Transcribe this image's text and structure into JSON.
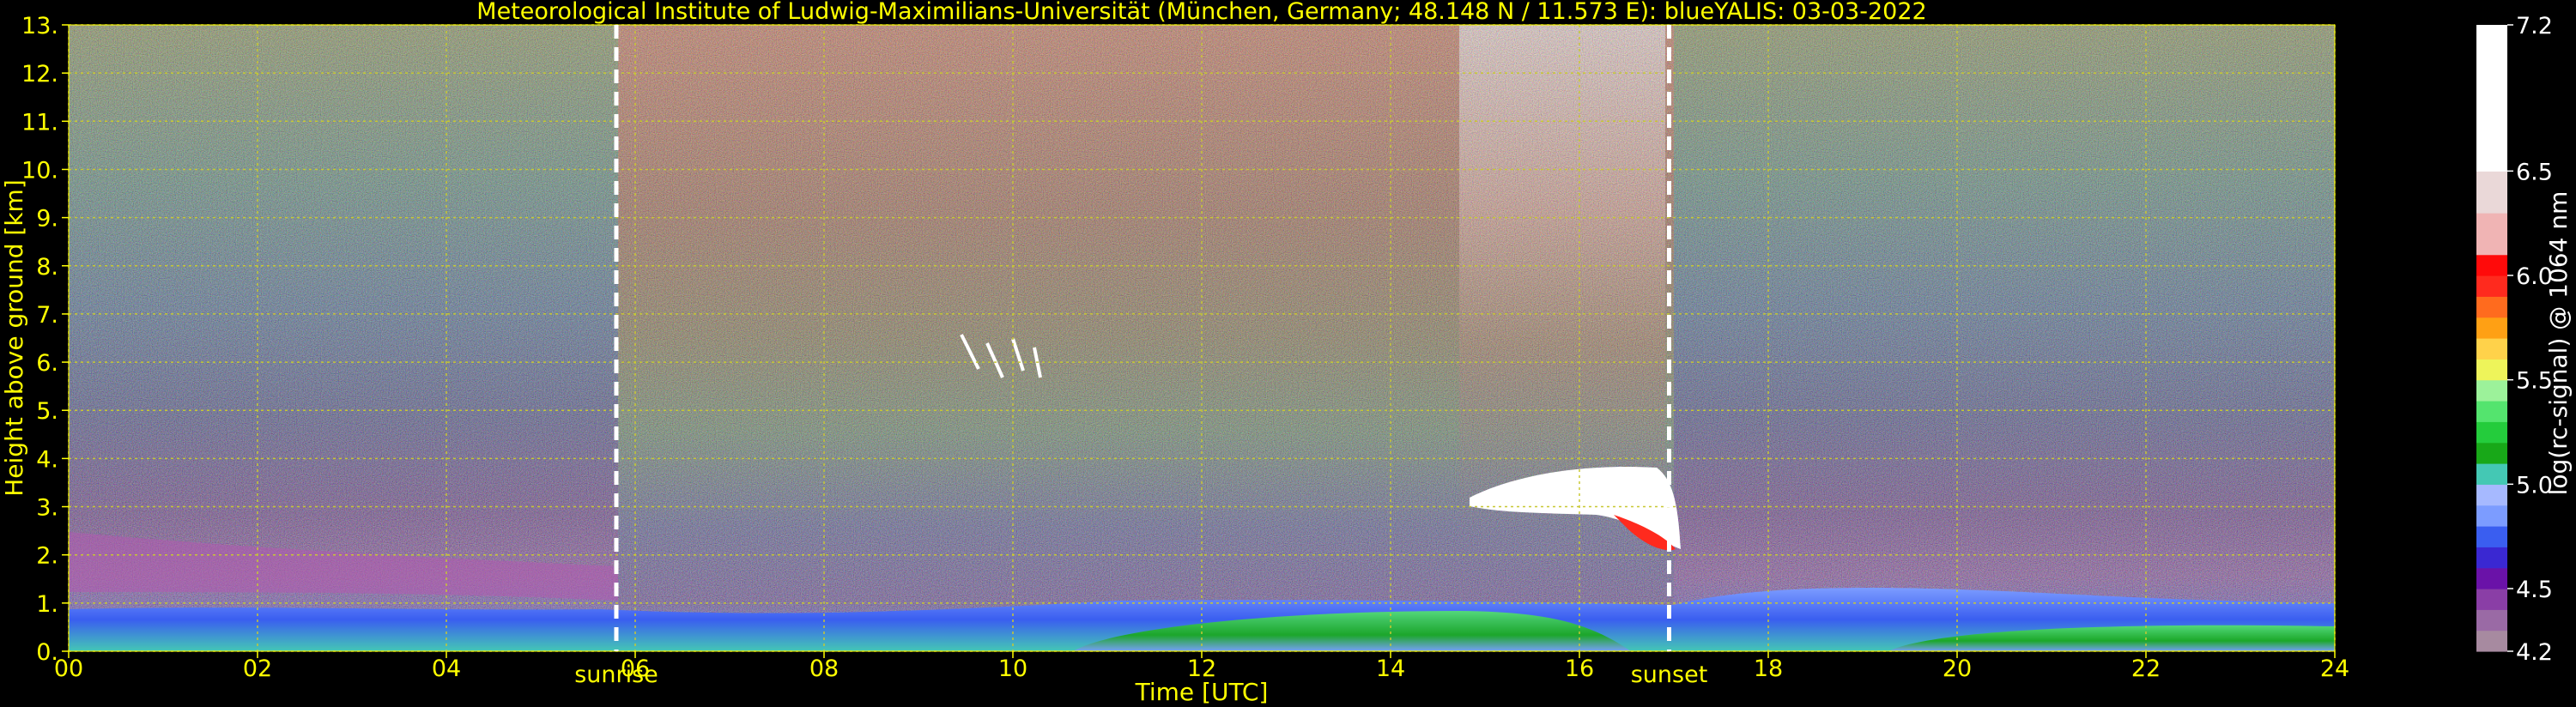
{
  "chart_data": {
    "type": "heatmap",
    "title": "Meteorological Institute of Ludwig-Maximilians-Universität (München, Germany; 48.148 N / 11.573 E):     blueYALIS: 03-03-2022",
    "xlabel": "Time [UTC]",
    "ylabel": "Height above ground [km]",
    "xlim": [
      0,
      24
    ],
    "ylim": [
      0,
      13
    ],
    "xticks": [
      "00",
      "02",
      "04",
      "06",
      "08",
      "10",
      "12",
      "14",
      "16",
      "18",
      "20",
      "22",
      "24"
    ],
    "yticks": [
      "0.",
      "1.",
      "2.",
      "3.",
      "4.",
      "5.",
      "6.",
      "7.",
      "8.",
      "9.",
      "10.",
      "11.",
      "12.",
      "13."
    ],
    "grid": true,
    "annotations": [
      {
        "label": "sunrise",
        "x": 5.8
      },
      {
        "label": "sunset",
        "x": 16.95
      }
    ],
    "colorbar": {
      "label": "log(rc-signal) @ 1064 nm",
      "range": [
        4.2,
        7.2
      ],
      "tick_values": [
        4.2,
        4.5,
        5.0,
        5.5,
        6.0,
        6.5,
        7.2
      ],
      "tick_labels": [
        "4.2",
        "4.5",
        "5.0",
        "5.5",
        "6.0",
        "6.5",
        "7.2"
      ],
      "levels": [
        {
          "from": 4.2,
          "to": 4.3,
          "color": "#a78aa0"
        },
        {
          "from": 4.3,
          "to": 4.4,
          "color": "#9a6aa5"
        },
        {
          "from": 4.4,
          "to": 4.5,
          "color": "#8a3ea6"
        },
        {
          "from": 4.5,
          "to": 4.6,
          "color": "#6a12a8"
        },
        {
          "from": 4.6,
          "to": 4.7,
          "color": "#3a28d2"
        },
        {
          "from": 4.7,
          "to": 4.8,
          "color": "#3a5ef0"
        },
        {
          "from": 4.8,
          "to": 4.9,
          "color": "#7c9cff"
        },
        {
          "from": 4.9,
          "to": 5.0,
          "color": "#a6b9ff"
        },
        {
          "from": 5.0,
          "to": 5.1,
          "color": "#44c8b4"
        },
        {
          "from": 5.1,
          "to": 5.2,
          "color": "#18a818"
        },
        {
          "from": 5.2,
          "to": 5.3,
          "color": "#24cc3c"
        },
        {
          "from": 5.3,
          "to": 5.4,
          "color": "#54e46e"
        },
        {
          "from": 5.4,
          "to": 5.5,
          "color": "#9cf29a"
        },
        {
          "from": 5.5,
          "to": 5.6,
          "color": "#eef45a"
        },
        {
          "from": 5.6,
          "to": 5.7,
          "color": "#ffd24a"
        },
        {
          "from": 5.7,
          "to": 5.8,
          "color": "#ffa014"
        },
        {
          "from": 5.8,
          "to": 5.9,
          "color": "#ff6b1e"
        },
        {
          "from": 5.9,
          "to": 6.0,
          "color": "#ff2a1e"
        },
        {
          "from": 6.0,
          "to": 6.1,
          "color": "#ff0a0a"
        },
        {
          "from": 6.1,
          "to": 6.3,
          "color": "#f0b4b4"
        },
        {
          "from": 6.3,
          "to": 6.5,
          "color": "#ead8d8"
        },
        {
          "from": 6.5,
          "to": 7.2,
          "color": "#ffffff"
        }
      ]
    },
    "colors": {
      "background": "#000000",
      "axis_text": "#ffff00",
      "grid": "#c8c832",
      "marker_lines": "#ffffff"
    }
  }
}
